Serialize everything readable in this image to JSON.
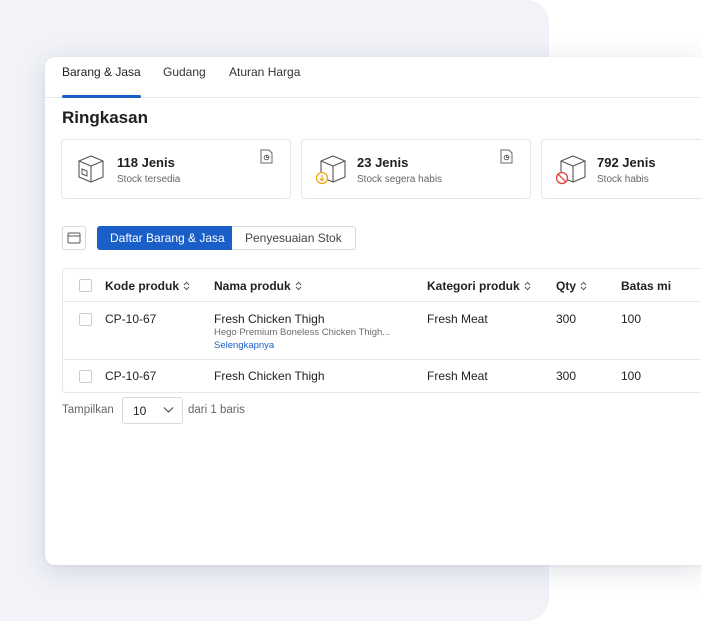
{
  "tabs": [
    {
      "label": "Barang & Jasa",
      "active": true
    },
    {
      "label": "Gudang",
      "active": false
    },
    {
      "label": "Aturan Harga",
      "active": false
    }
  ],
  "summary": {
    "title": "Ringkasan",
    "cards": [
      {
        "count": "118 Jenis",
        "label": "Stock tersedia",
        "icon": "box-icon"
      },
      {
        "count": "23 Jenis",
        "label": "Stock segera habis",
        "icon": "box-warning-icon"
      },
      {
        "count": "792 Jenis",
        "label": "Stock habis",
        "icon": "box-empty-icon"
      }
    ]
  },
  "segments": {
    "active": "Daftar Barang & Jasa",
    "inactive": "Penyesuaian Stok"
  },
  "table": {
    "headers": [
      "Kode produk",
      "Nama produk",
      "Kategori produk",
      "Qty",
      "Batas mi"
    ],
    "rows": [
      {
        "code": "CP-10-67",
        "name": "Fresh Chicken Thigh",
        "desc": "Hego Premium Boneless Chicken Thigh...",
        "more": "Selengkapnya",
        "category": "Fresh Meat",
        "qty": "300",
        "limit": "100"
      },
      {
        "code": "CP-10-67",
        "name": "Fresh Chicken Thigh",
        "category": "Fresh Meat",
        "qty": "300",
        "limit": "100"
      }
    ]
  },
  "pagination": {
    "prefix": "Tampilkan",
    "page_size": "10",
    "suffix": "dari 1 baris"
  },
  "colors": {
    "accent": "#1a5fc8",
    "warning": "#f2a516",
    "danger": "#e0413a"
  }
}
